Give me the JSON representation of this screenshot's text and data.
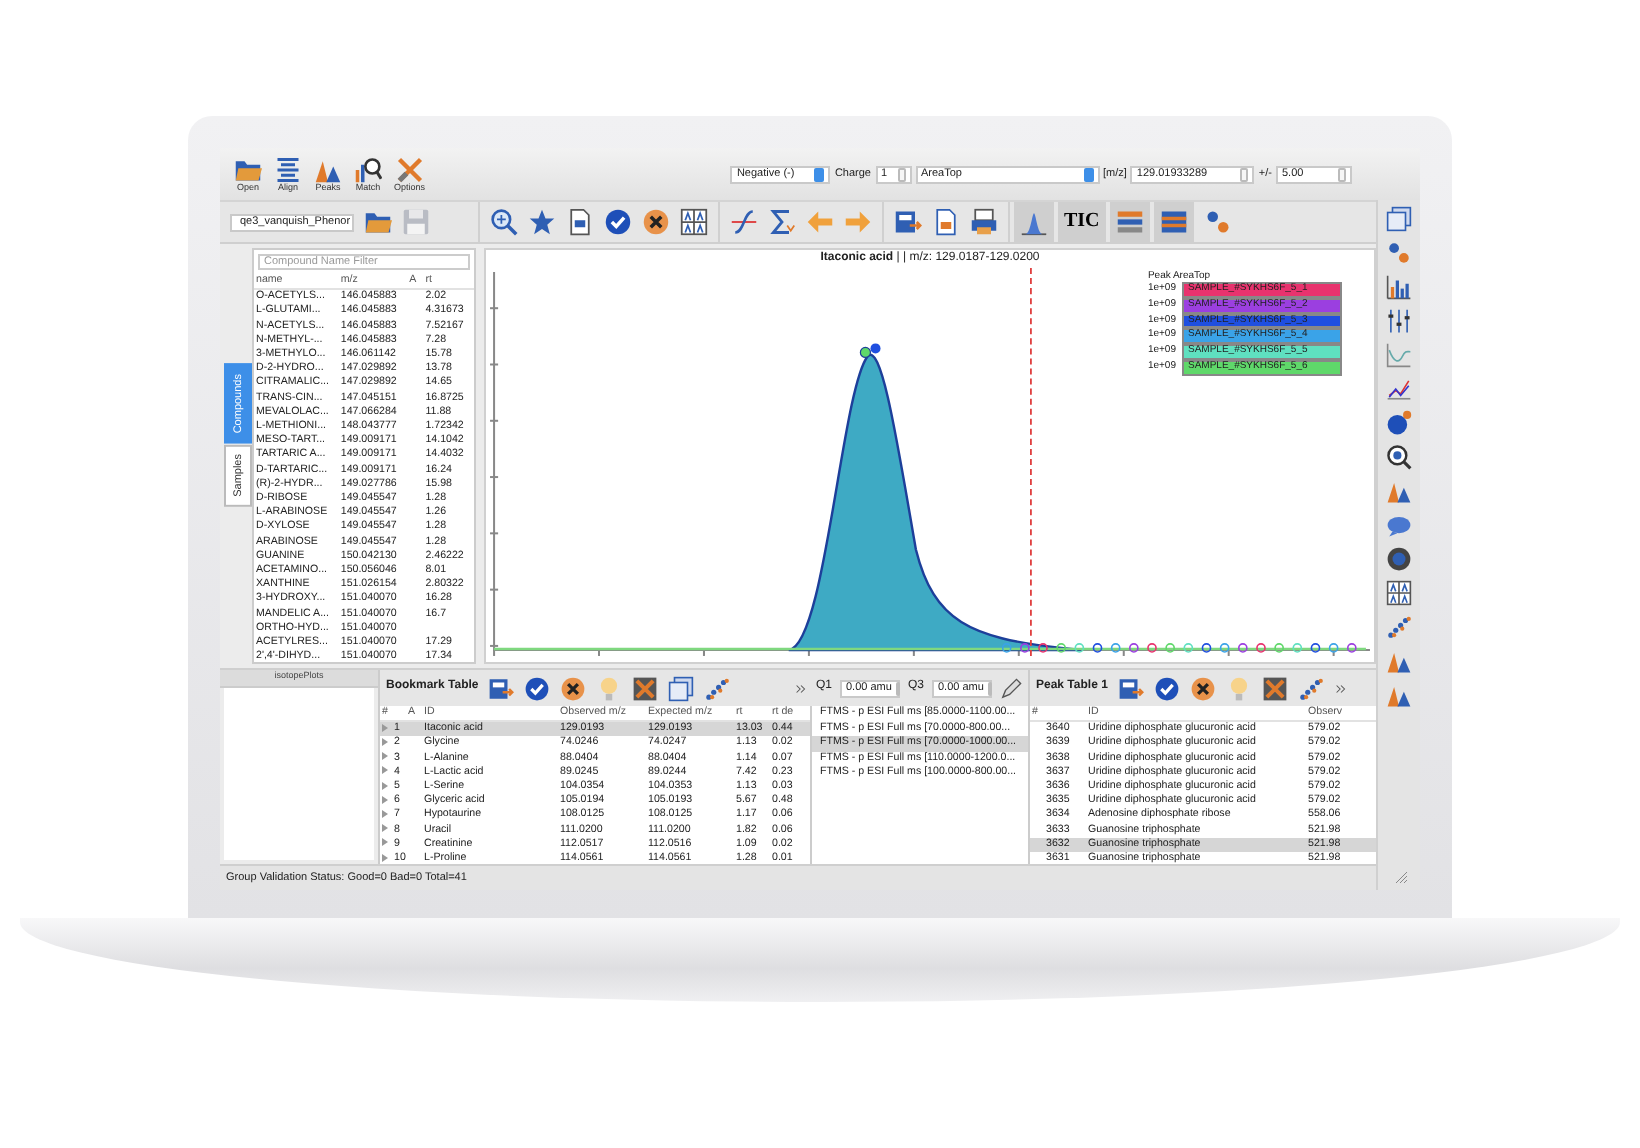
{
  "toolbar": {
    "buttons": [
      {
        "label": "Open"
      },
      {
        "label": "Align"
      },
      {
        "label": "Peaks"
      },
      {
        "label": "Match"
      },
      {
        "label": "Options"
      }
    ]
  },
  "controls": {
    "ionization": "Negative (-)",
    "charge_label": "Charge",
    "charge": "1",
    "quant_type": "AreaTop",
    "mz_label": "[m/z]",
    "mz": "129.01933289",
    "tolerance_label": "+/-",
    "tolerance": "5.00"
  },
  "dataset": {
    "value": "qe3_vanquish_Phenor"
  },
  "view_toggles": [
    {
      "pressed": true
    },
    {
      "pressed": true
    },
    {
      "pressed": true
    },
    {
      "pressed": false
    }
  ],
  "tic_button": {
    "label": "TIC",
    "pressed": true
  },
  "side_tabs": [
    {
      "label": "Compounds",
      "selected": true
    },
    {
      "label": "Samples",
      "selected": false
    }
  ],
  "compounds": {
    "placeholder": "Compound Name Filter",
    "columns": [
      "name",
      "m/z",
      "A",
      "rt"
    ],
    "rows": [
      {
        "name": "O-ACETYLS...",
        "mz": "146.045883",
        "rt": "2.02"
      },
      {
        "name": "L-GLUTAMI...",
        "mz": "146.045883",
        "rt": "4.31673"
      },
      {
        "name": "N-ACETYLS...",
        "mz": "146.045883",
        "rt": "7.52167"
      },
      {
        "name": "N-METHYL-...",
        "mz": "146.045883",
        "rt": "7.28"
      },
      {
        "name": "3-METHYLO...",
        "mz": "146.061142",
        "rt": "15.78"
      },
      {
        "name": "D-2-HYDRO...",
        "mz": "147.029892",
        "rt": "13.78"
      },
      {
        "name": "CITRAMALIC...",
        "mz": "147.029892",
        "rt": "14.65"
      },
      {
        "name": "TRANS-CIN...",
        "mz": "147.045151",
        "rt": "16.8725"
      },
      {
        "name": "MEVALOLAC...",
        "mz": "147.066284",
        "rt": "11.88"
      },
      {
        "name": "L-METHIONI...",
        "mz": "148.043777",
        "rt": "1.72342"
      },
      {
        "name": "MESO-TART...",
        "mz": "149.009171",
        "rt": "14.1042"
      },
      {
        "name": "TARTARIC A...",
        "mz": "149.009171",
        "rt": "14.4032"
      },
      {
        "name": "D-TARTARIC...",
        "mz": "149.009171",
        "rt": "16.24"
      },
      {
        "name": "(R)-2-HYDR...",
        "mz": "149.027786",
        "rt": "15.98"
      },
      {
        "name": "D-RIBOSE",
        "mz": "149.045547",
        "rt": "1.28"
      },
      {
        "name": "L-ARABINOSE",
        "mz": "149.045547",
        "rt": "1.26"
      },
      {
        "name": "D-XYLOSE",
        "mz": "149.045547",
        "rt": "1.28"
      },
      {
        "name": "ARABINOSE",
        "mz": "149.045547",
        "rt": "1.28"
      },
      {
        "name": "GUANINE",
        "mz": "150.042130",
        "rt": "2.46222"
      },
      {
        "name": "ACETAMINO...",
        "mz": "150.056046",
        "rt": "8.01"
      },
      {
        "name": "XANTHINE",
        "mz": "151.026154",
        "rt": "2.80322"
      },
      {
        "name": "3-HYDROXY...",
        "mz": "151.040070",
        "rt": "16.28"
      },
      {
        "name": "MANDELIC A...",
        "mz": "151.040070",
        "rt": "16.7"
      },
      {
        "name": "ORTHO-HYD...",
        "mz": "151.040070"
      },
      {
        "name": "ACETYLRES...",
        "mz": "151.040070",
        "rt": "17.29"
      },
      {
        "name": "2',4'-DIHYD...",
        "mz": "151.040070",
        "rt": "17.34"
      }
    ]
  },
  "chart": {
    "title": "**Itaconic acid** | | m/z: 129.0187-129.0200",
    "legend_title": "Peak AreaTop",
    "legend": [
      {
        "value": "1e+09",
        "name": "SAMPLE_#SYKHS6F_5_1",
        "color": "#e8336e"
      },
      {
        "value": "1e+09",
        "name": "SAMPLE_#SYKHS6F_5_2",
        "color": "#9b3fe0"
      },
      {
        "value": "1e+09",
        "name": "SAMPLE_#SYKHS6F_5_3",
        "color": "#1f4fe0"
      },
      {
        "value": "1e+09",
        "name": "SAMPLE_#SYKHS6F_5_4",
        "color": "#3aa3e8"
      },
      {
        "value": "1e+09",
        "name": "SAMPLE_#SYKHS6F_5_5",
        "color": "#5fe0c0"
      },
      {
        "value": "1e+09",
        "name": "SAMPLE_#SYKHS6F_5_6",
        "color": "#5fd86a"
      }
    ]
  },
  "isotope_panel": {
    "title": "isotopePlots"
  },
  "bookmark_table": {
    "title": "Bookmark Table",
    "columns": [
      "#",
      "A",
      "ID",
      "Observed m/z",
      "Expected m/z",
      "rt",
      "rt de"
    ],
    "rows": [
      {
        "cells": [
          "1",
          "",
          "Itaconic acid",
          "129.0193",
          "129.0193",
          "13.03",
          "0.44"
        ],
        "selected": true
      },
      {
        "cells": [
          "2",
          "",
          "Glycine",
          "74.0246",
          "74.0247",
          "1.13",
          "0.02"
        ],
        "selected": false
      },
      {
        "cells": [
          "3",
          "",
          "L-Alanine",
          "88.0404",
          "88.0404",
          "1.14",
          "0.07"
        ],
        "selected": false
      },
      {
        "cells": [
          "4",
          "",
          "L-Lactic acid",
          "89.0245",
          "89.0244",
          "7.42",
          "0.23"
        ],
        "selected": false
      },
      {
        "cells": [
          "5",
          "",
          "L-Serine",
          "104.0354",
          "104.0353",
          "1.13",
          "0.03"
        ],
        "selected": false
      },
      {
        "cells": [
          "6",
          "",
          "Glyceric acid",
          "105.0194",
          "105.0193",
          "5.67",
          "0.48"
        ],
        "selected": false
      },
      {
        "cells": [
          "7",
          "",
          "Hypotaurine",
          "108.0125",
          "108.0125",
          "1.17",
          "0.06"
        ],
        "selected": false
      },
      {
        "cells": [
          "8",
          "",
          "Uracil",
          "111.0200",
          "111.0200",
          "1.82",
          "0.06"
        ],
        "selected": false
      },
      {
        "cells": [
          "9",
          "",
          "Creatinine",
          "112.0517",
          "112.0516",
          "1.09",
          "0.02"
        ],
        "selected": false
      },
      {
        "cells": [
          "10",
          "",
          "L-Proline",
          "114.0561",
          "114.0561",
          "1.28",
          "0.01"
        ],
        "selected": false
      }
    ]
  },
  "srm": {
    "q1_label": "Q1",
    "q1": "0.00 amu",
    "q3_label": "Q3",
    "q3": "0.00 amu",
    "items": [
      {
        "label": "FTMS - p ESI Full ms [85.0000-1100.00...",
        "selected": false
      },
      {
        "label": "FTMS - p ESI Full ms [70.0000-800.00...",
        "selected": false
      },
      {
        "label": "FTMS - p ESI Full ms [70.0000-1000.00...",
        "selected": true
      },
      {
        "label": "FTMS - p ESI Full ms [110.0000-1200.0...",
        "selected": false
      },
      {
        "label": "FTMS - p ESI Full ms [100.0000-800.00...",
        "selected": false
      }
    ]
  },
  "peak_table": {
    "title": "Peak Table 1",
    "columns": [
      "#",
      "ID",
      "Observ"
    ],
    "rows": [
      {
        "cells": [
          "3640",
          "Uridine diphosphate glucuronic acid",
          "579.02"
        ],
        "selected": false
      },
      {
        "cells": [
          "3639",
          "Uridine diphosphate glucuronic acid",
          "579.02"
        ],
        "selected": false
      },
      {
        "cells": [
          "3638",
          "Uridine diphosphate glucuronic acid",
          "579.02"
        ],
        "selected": false
      },
      {
        "cells": [
          "3637",
          "Uridine diphosphate glucuronic acid",
          "579.02"
        ],
        "selected": false
      },
      {
        "cells": [
          "3636",
          "Uridine diphosphate glucuronic acid",
          "579.02"
        ],
        "selected": false
      },
      {
        "cells": [
          "3635",
          "Uridine diphosphate glucuronic acid",
          "579.02"
        ],
        "selected": false
      },
      {
        "cells": [
          "3634",
          "Adenosine diphosphate ribose",
          "558.06"
        ],
        "selected": false
      },
      {
        "cells": [
          "3633",
          "Guanosine triphosphate",
          "521.98"
        ],
        "selected": false
      },
      {
        "cells": [
          "3632",
          "Guanosine triphosphate",
          "521.98"
        ],
        "selected": true
      },
      {
        "cells": [
          "3631",
          "Guanosine triphosphate",
          "521.98"
        ],
        "selected": false
      }
    ]
  },
  "status_bar": "Group Validation Status: Good=0 Bad=0 Total=41"
}
